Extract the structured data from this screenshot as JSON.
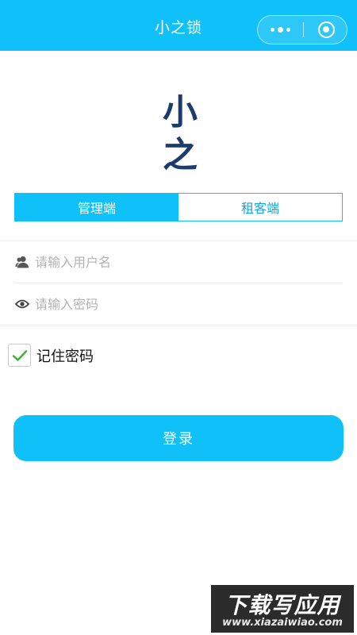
{
  "nav": {
    "title": "小之锁"
  },
  "logo": {
    "text": "小之"
  },
  "tabs": [
    {
      "label": "管理端",
      "active": true
    },
    {
      "label": "租客端",
      "active": false
    }
  ],
  "form": {
    "username": {
      "placeholder": "请输入用户名",
      "value": ""
    },
    "password": {
      "placeholder": "请输入密码",
      "value": ""
    }
  },
  "remember": {
    "label": "记住密码",
    "checked": true
  },
  "login_button": {
    "label": "登录"
  },
  "watermark": {
    "title": "下载写应用",
    "url": "www.xiazaiwiao.com"
  },
  "colors": {
    "primary": "#10c0f8",
    "logo": "#1c3c70",
    "check": "#3cb034"
  },
  "icons": [
    "more-icon",
    "close-circle-icon",
    "user-icon",
    "eye-icon",
    "checkmark-icon"
  ]
}
